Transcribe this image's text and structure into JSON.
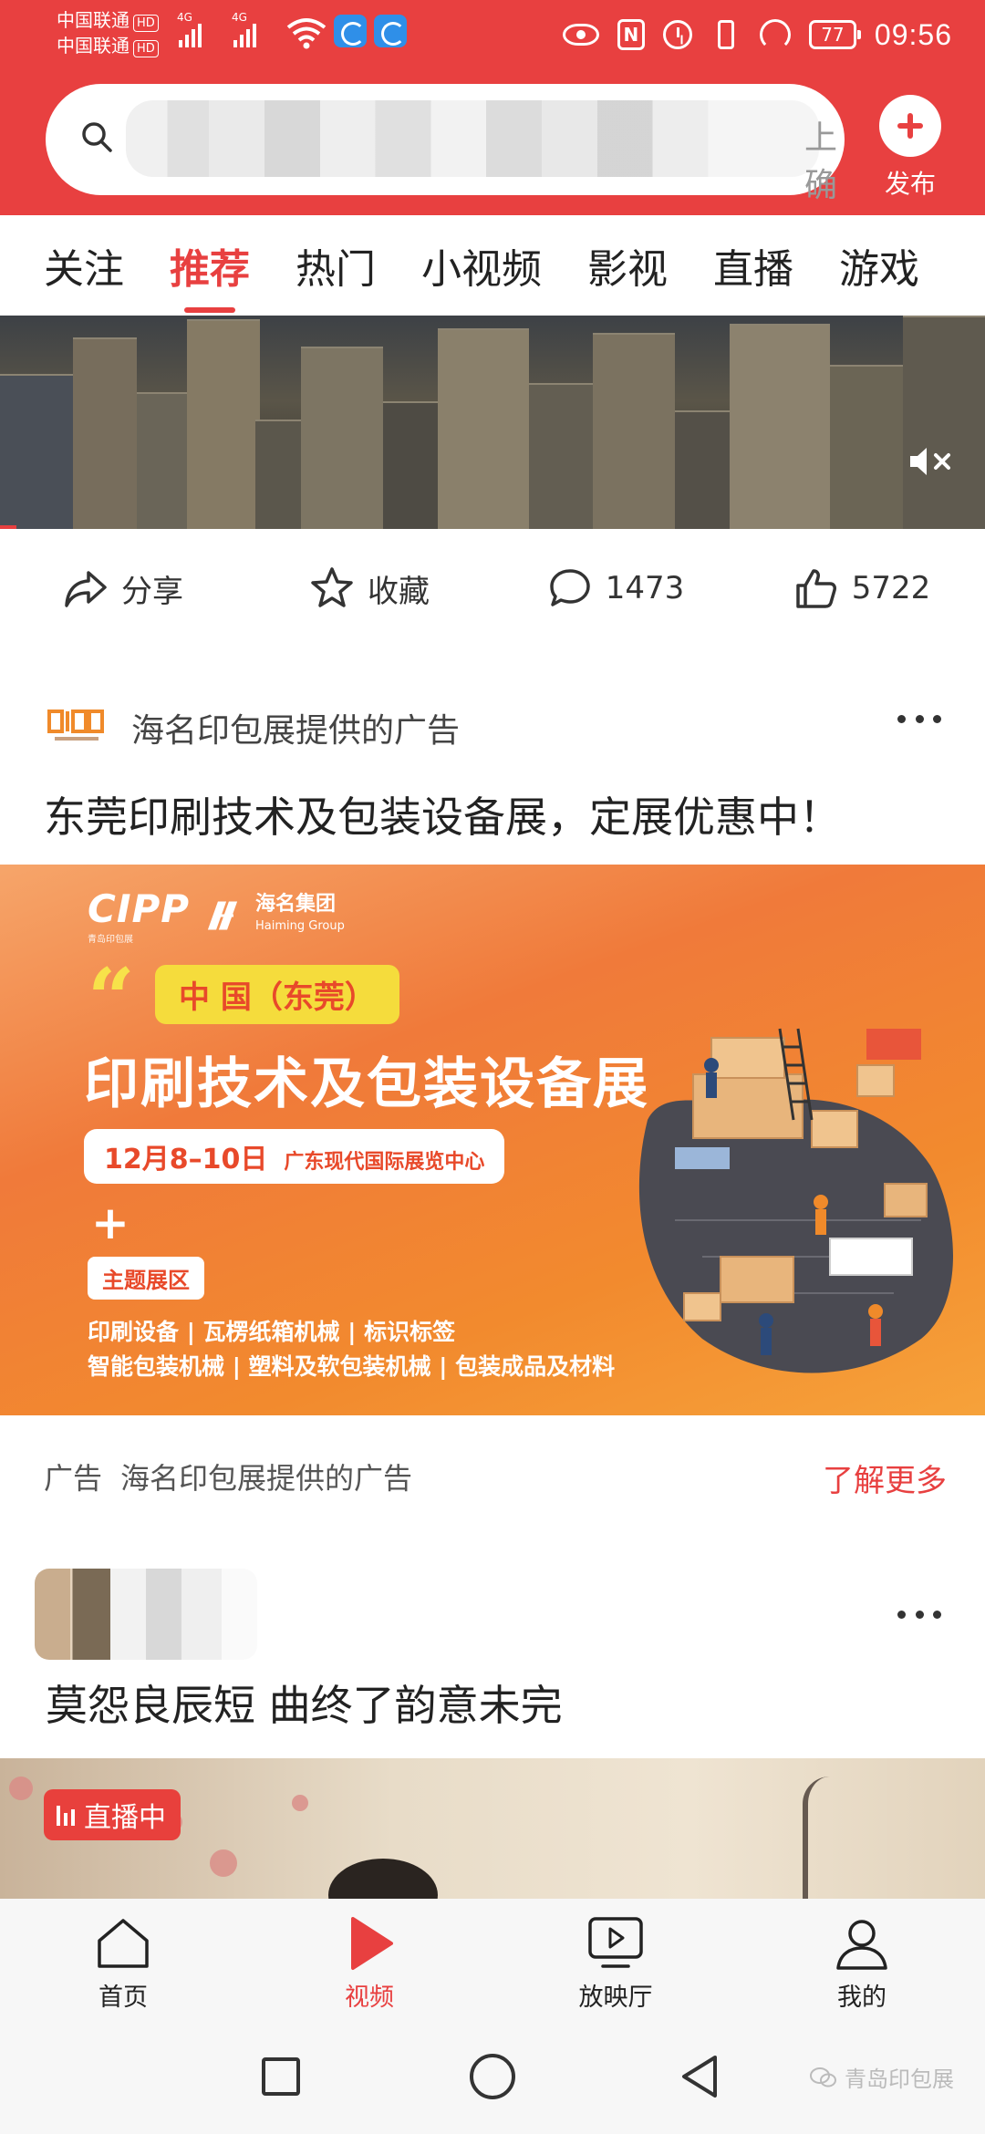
{
  "status_bar": {
    "carrier_1": "中国联通",
    "carrier_2": "中国联通",
    "hd": "HD",
    "net_1": "4G",
    "net_2": "4G",
    "nfc": "N",
    "battery": "77",
    "time": "09:56"
  },
  "search": {
    "hint_tail": "上确"
  },
  "publish": {
    "label": "发布"
  },
  "tabs": [
    {
      "label": "关注"
    },
    {
      "label": "推荐"
    },
    {
      "label": "热门"
    },
    {
      "label": "小视频"
    },
    {
      "label": "影视"
    },
    {
      "label": "直播"
    },
    {
      "label": "游戏"
    }
  ],
  "active_tab": "推荐",
  "actions": {
    "share": "分享",
    "favorite": "收藏",
    "comments": "1473",
    "likes": "5722"
  },
  "ad": {
    "source": "海名印包展提供的广告",
    "title": "东莞印刷技术及包装设备展，定展优惠中！",
    "banner": {
      "logo_text": "CIPP",
      "logo_small": "青岛印包展",
      "group_name": "海名集团",
      "group_en": "Haiming Group",
      "tag": "中 国（东莞）",
      "headline": "印刷技术及包装设备展",
      "date": "12月8–10日",
      "venue": "广东现代国际展览中心",
      "plus": "+",
      "zone": "主题展区",
      "categories_line1": "印刷设备 | 瓦楞纸箱机械 | 标识标签",
      "categories_line2": "智能包装机械 | 塑料及软包装机械 | 包装成品及材料"
    },
    "footer_label": "广告",
    "footer_source": "海名印包展提供的广告",
    "more": "了解更多"
  },
  "post": {
    "title": "莫怨良辰短 曲终了韵意未完",
    "live_badge": "直播中"
  },
  "bottom_nav": [
    {
      "label": "首页",
      "icon": "home-icon"
    },
    {
      "label": "视频",
      "icon": "video-play-icon"
    },
    {
      "label": "放映厅",
      "icon": "screening-room-icon"
    },
    {
      "label": "我的",
      "icon": "profile-icon"
    }
  ],
  "active_nav": "视频",
  "watermark": "青岛印包展",
  "colors": {
    "brand_red": "#e84040",
    "banner_orange": "#f07a3a",
    "banner_yellow": "#f5dc3c"
  }
}
